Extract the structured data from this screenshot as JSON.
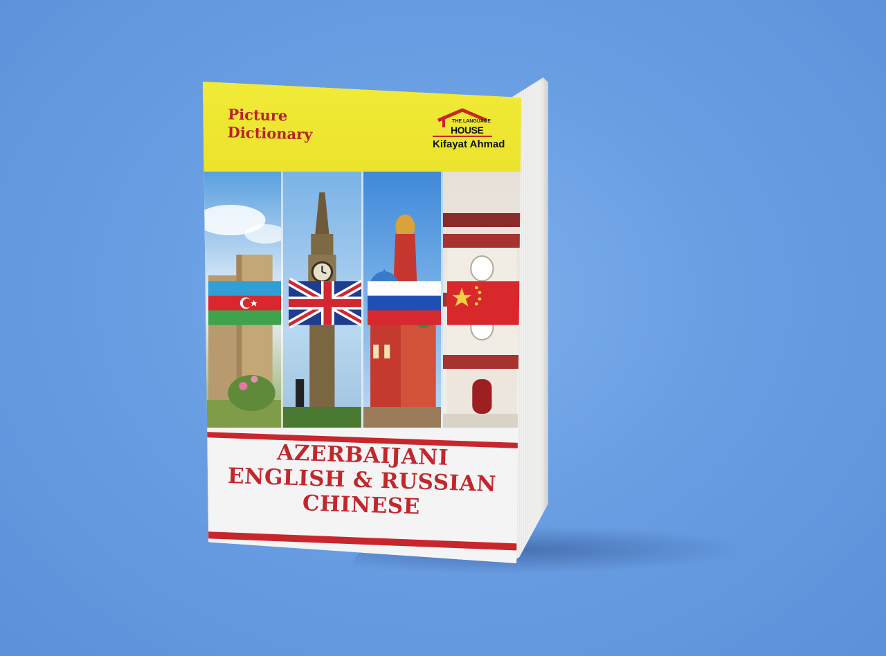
{
  "cover": {
    "series_label_line1": "Picture",
    "series_label_line2": "Dictionary",
    "publisher": {
      "logo_small_text": "THE LANGUAGE",
      "logo_big_text": "HOUSE",
      "author": "Kifayat Ahmad"
    },
    "title_lines": [
      "AZERBAIJANI",
      "ENGLISH & RUSSIAN",
      "CHINESE"
    ]
  },
  "panels": [
    {
      "name": "azerbaijan",
      "flag": "azerbaijan-flag-icon"
    },
    {
      "name": "england",
      "flag": "uk-flag-icon"
    },
    {
      "name": "russia",
      "flag": "russia-flag-icon"
    },
    {
      "name": "china",
      "flag": "china-flag-icon"
    }
  ],
  "colors": {
    "background": "#6a9ee3",
    "cover_yellow": "#ebe32c",
    "title_red": "#c1272d"
  }
}
